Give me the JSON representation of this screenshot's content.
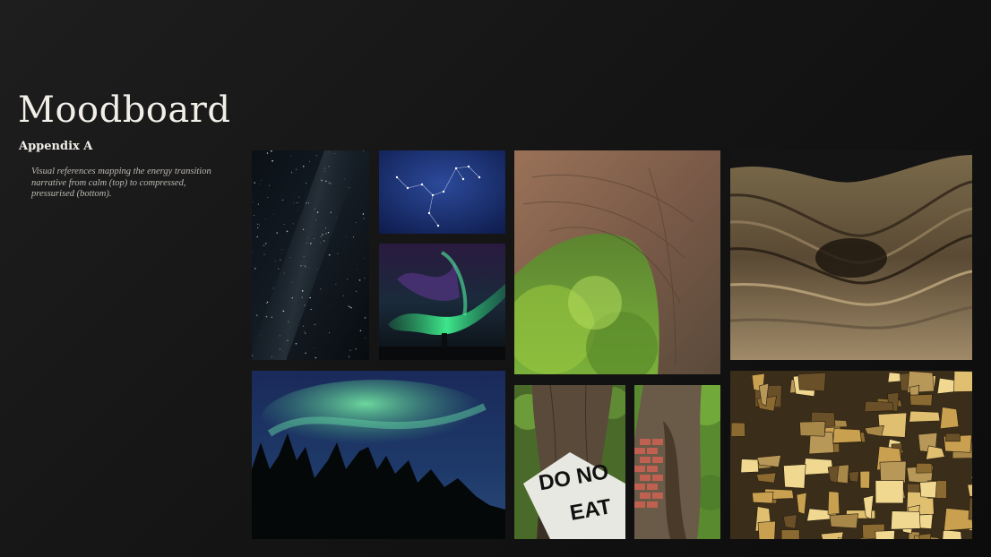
{
  "header": {
    "title": "Moodboard",
    "subtitle": "Appendix A",
    "description": "Visual references mapping the energy transition narrative from calm (top) to compressed, pressurised (bottom)."
  },
  "images": [
    {
      "name": "starfield-image"
    },
    {
      "name": "constellation-image"
    },
    {
      "name": "aurora-image"
    },
    {
      "name": "tree-trunk-image"
    },
    {
      "name": "rock-strata-image"
    },
    {
      "name": "aurora-forest-image"
    },
    {
      "name": "do-not-eat-sign-image",
      "sign_line1": "DO NO",
      "sign_line2": "EAT"
    },
    {
      "name": "tree-bricks-image"
    },
    {
      "name": "pyrite-crystals-image"
    }
  ]
}
